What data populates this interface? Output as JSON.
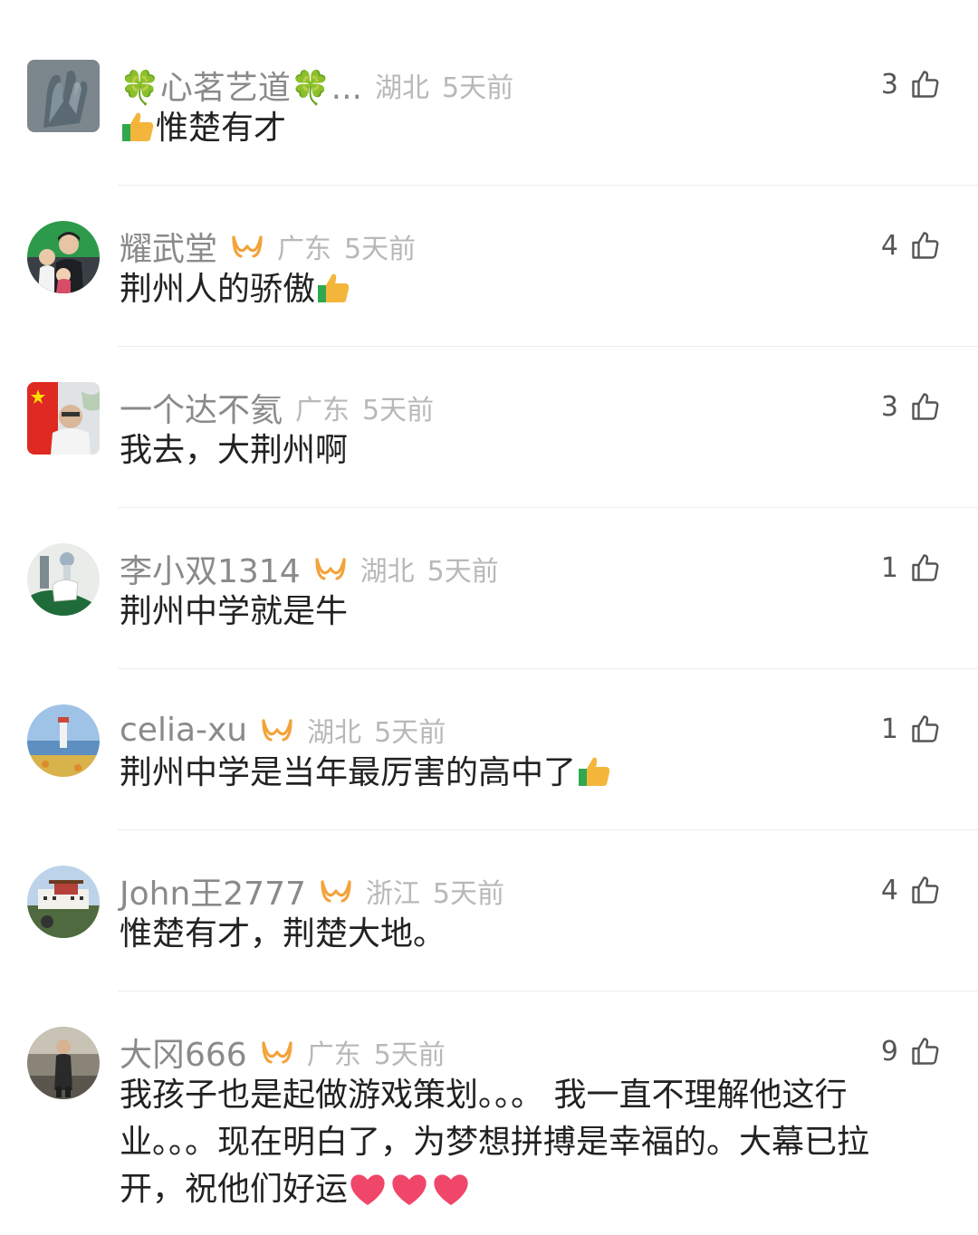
{
  "comments": [
    {
      "name": "🍀心茗艺道🍀...",
      "vip": false,
      "location": "湖北",
      "time": "5天前",
      "likes": "3",
      "text": "惟楚有才",
      "emoji_prefix": "thumbs-up-emoji",
      "avatar": "hand-statue"
    },
    {
      "name": "耀武堂",
      "vip": true,
      "location": "广东",
      "time": "5天前",
      "likes": "4",
      "text": "荆州人的骄傲",
      "emoji_suffix": "thumbs-up-emoji",
      "avatar": "people-photo"
    },
    {
      "name": "一个达不氦",
      "vip": false,
      "location": "广东",
      "time": "5天前",
      "likes": "3",
      "text": "我去，大荆州啊",
      "avatar": "flag-portrait"
    },
    {
      "name": "李小双1314",
      "vip": true,
      "location": "湖北",
      "time": "5天前",
      "likes": "1",
      "text": "荆州中学就是牛",
      "avatar": "lab-person"
    },
    {
      "name": "celia-xu",
      "vip": true,
      "location": "湖北",
      "time": "5天前",
      "likes": "1",
      "text": "荆州中学是当年最厉害的高中了",
      "emoji_suffix": "thumbs-up-emoji",
      "avatar": "lighthouse"
    },
    {
      "name": "John王2777",
      "vip": true,
      "location": "浙江",
      "time": "5天前",
      "likes": "4",
      "text": "惟楚有才，荆楚大地。",
      "avatar": "palace"
    },
    {
      "name": "大冈666",
      "vip": true,
      "location": "广东",
      "time": "5天前",
      "likes": "9",
      "text": "我孩子也是起做游戏策划。。。 我一直不理解他这行业。。。现在明白了，为梦想拼搏是幸福的。大幕已拉开，祝他们好运",
      "hearts": 3,
      "avatar": "person-standing"
    }
  ],
  "colors": {
    "vip": "#f2a33a",
    "heart": "#f0466a",
    "name": "#8a8a8a",
    "meta": "#b8b8b8"
  }
}
